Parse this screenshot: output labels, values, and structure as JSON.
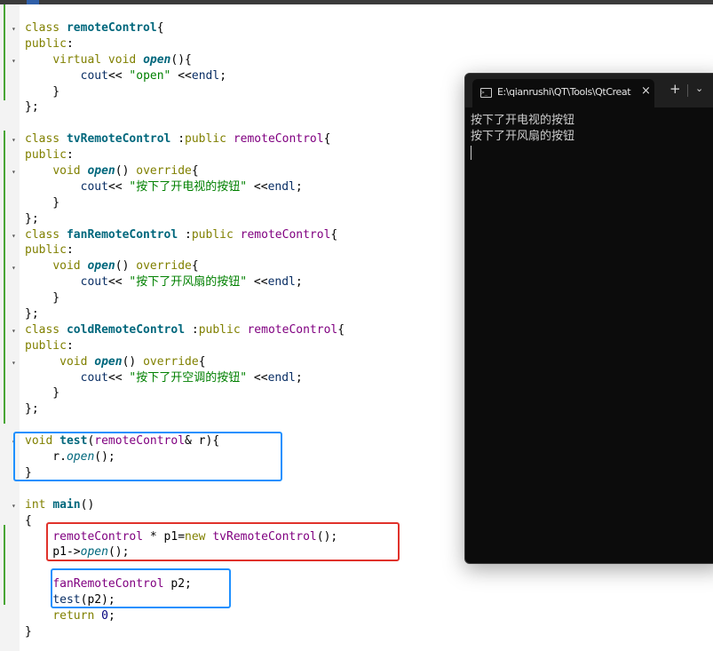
{
  "editor": {
    "lines": [
      [
        [
          "kw",
          "class "
        ],
        [
          "fn",
          "remoteControl"
        ],
        [
          "op",
          "{"
        ]
      ],
      [
        [
          "kw",
          "public"
        ],
        [
          "op",
          ":"
        ]
      ],
      [
        [
          "op",
          "    "
        ],
        [
          "kw",
          "virtual void "
        ],
        [
          "fn-italic",
          "open"
        ],
        [
          "op",
          "(){"
        ]
      ],
      [
        [
          "op",
          "        "
        ],
        [
          "id",
          "cout"
        ],
        [
          "op",
          "<< "
        ],
        [
          "str",
          "\"open\""
        ],
        [
          "op",
          " <<"
        ],
        [
          "id",
          "endl"
        ],
        [
          "op",
          ";"
        ]
      ],
      [
        [
          "op",
          "    }"
        ]
      ],
      [
        [
          "op",
          "};"
        ]
      ],
      [
        [
          "op",
          ""
        ]
      ],
      [
        [
          "kw",
          "class "
        ],
        [
          "fn",
          "tvRemoteControl"
        ],
        [
          "op",
          " :"
        ],
        [
          "kw",
          "public "
        ],
        [
          "cls",
          "remoteControl"
        ],
        [
          "op",
          "{"
        ]
      ],
      [
        [
          "kw",
          "public"
        ],
        [
          "op",
          ":"
        ]
      ],
      [
        [
          "op",
          "    "
        ],
        [
          "kw",
          "void "
        ],
        [
          "fn-italic",
          "open"
        ],
        [
          "op",
          "() "
        ],
        [
          "kw",
          "override"
        ],
        [
          "op",
          "{"
        ]
      ],
      [
        [
          "op",
          "        "
        ],
        [
          "id",
          "cout"
        ],
        [
          "op",
          "<< "
        ],
        [
          "str",
          "\"按下了开电视的按钮\""
        ],
        [
          "op",
          " <<"
        ],
        [
          "id",
          "endl"
        ],
        [
          "op",
          ";"
        ]
      ],
      [
        [
          "op",
          "    }"
        ]
      ],
      [
        [
          "op",
          "};"
        ]
      ],
      [
        [
          "kw",
          "class "
        ],
        [
          "fn",
          "fanRemoteControl"
        ],
        [
          "op",
          " :"
        ],
        [
          "kw",
          "public "
        ],
        [
          "cls",
          "remoteControl"
        ],
        [
          "op",
          "{"
        ]
      ],
      [
        [
          "kw",
          "public"
        ],
        [
          "op",
          ":"
        ]
      ],
      [
        [
          "op",
          "    "
        ],
        [
          "kw",
          "void "
        ],
        [
          "fn-italic",
          "open"
        ],
        [
          "op",
          "() "
        ],
        [
          "kw",
          "override"
        ],
        [
          "op",
          "{"
        ]
      ],
      [
        [
          "op",
          "        "
        ],
        [
          "id",
          "cout"
        ],
        [
          "op",
          "<< "
        ],
        [
          "str",
          "\"按下了开风扇的按钮\""
        ],
        [
          "op",
          " <<"
        ],
        [
          "id",
          "endl"
        ],
        [
          "op",
          ";"
        ]
      ],
      [
        [
          "op",
          "    }"
        ]
      ],
      [
        [
          "op",
          "};"
        ]
      ],
      [
        [
          "kw",
          "class "
        ],
        [
          "fn",
          "coldRemoteControl"
        ],
        [
          "op",
          " :"
        ],
        [
          "kw",
          "public "
        ],
        [
          "cls",
          "remoteControl"
        ],
        [
          "op",
          "{"
        ]
      ],
      [
        [
          "kw",
          "public"
        ],
        [
          "op",
          ":"
        ]
      ],
      [
        [
          "op",
          "     "
        ],
        [
          "kw",
          "void "
        ],
        [
          "fn-italic",
          "open"
        ],
        [
          "op",
          "() "
        ],
        [
          "kw",
          "override"
        ],
        [
          "op",
          "{"
        ]
      ],
      [
        [
          "op",
          "        "
        ],
        [
          "id",
          "cout"
        ],
        [
          "op",
          "<< "
        ],
        [
          "str",
          "\"按下了开空调的按钮\""
        ],
        [
          "op",
          " <<"
        ],
        [
          "id",
          "endl"
        ],
        [
          "op",
          ";"
        ]
      ],
      [
        [
          "op",
          "    }"
        ]
      ],
      [
        [
          "op",
          "};"
        ]
      ],
      [
        [
          "op",
          ""
        ]
      ],
      [
        [
          "kw",
          "void "
        ],
        [
          "fn",
          "test"
        ],
        [
          "op",
          "("
        ],
        [
          "cls",
          "remoteControl"
        ],
        [
          "op",
          "& r){"
        ]
      ],
      [
        [
          "op",
          "    r."
        ],
        [
          "fn-call",
          "open"
        ],
        [
          "op",
          "();"
        ]
      ],
      [
        [
          "op",
          "}"
        ]
      ],
      [
        [
          "op",
          ""
        ]
      ],
      [
        [
          "kw",
          "int "
        ],
        [
          "fn",
          "main"
        ],
        [
          "op",
          "()"
        ]
      ],
      [
        [
          "op",
          "{"
        ]
      ],
      [
        [
          "op",
          "    "
        ],
        [
          "cls",
          "remoteControl"
        ],
        [
          "op",
          " * p1="
        ],
        [
          "kw",
          "new "
        ],
        [
          "cls",
          "tvRemoteControl"
        ],
        [
          "op",
          "();"
        ]
      ],
      [
        [
          "op",
          "    p1->"
        ],
        [
          "fn-call",
          "open"
        ],
        [
          "op",
          "();"
        ]
      ],
      [
        [
          "op",
          ""
        ]
      ],
      [
        [
          "op",
          "    "
        ],
        [
          "cls",
          "fanRemoteControl"
        ],
        [
          "op",
          " p2;"
        ]
      ],
      [
        [
          "op",
          "    "
        ],
        [
          "id",
          "test"
        ],
        [
          "op",
          "(p2);"
        ]
      ],
      [
        [
          "op",
          "    "
        ],
        [
          "kw",
          "return "
        ],
        [
          "num",
          "0"
        ],
        [
          "op",
          ";"
        ]
      ],
      [
        [
          "op",
          "}"
        ]
      ]
    ]
  },
  "terminal": {
    "tab_title": "E:\\qianrushi\\QT\\Tools\\QtCreat",
    "tab_close": "×",
    "new_tab": "+",
    "dropdown": "⌄",
    "output_lines": [
      "按下了开电视的按钮",
      "按下了开风扇的按钮"
    ]
  },
  "colors": {
    "keyword": "#808000",
    "class_name": "#800080",
    "function": "#00677c",
    "string": "#008000",
    "highlight_blue": "#1e90ff",
    "highlight_red": "#e0322b",
    "terminal_bg": "#0c0c0c"
  },
  "icons": [
    "terminal-tab-icon",
    "close-icon",
    "plus-icon",
    "chevron-down-icon",
    "fold-arrow-icon"
  ]
}
